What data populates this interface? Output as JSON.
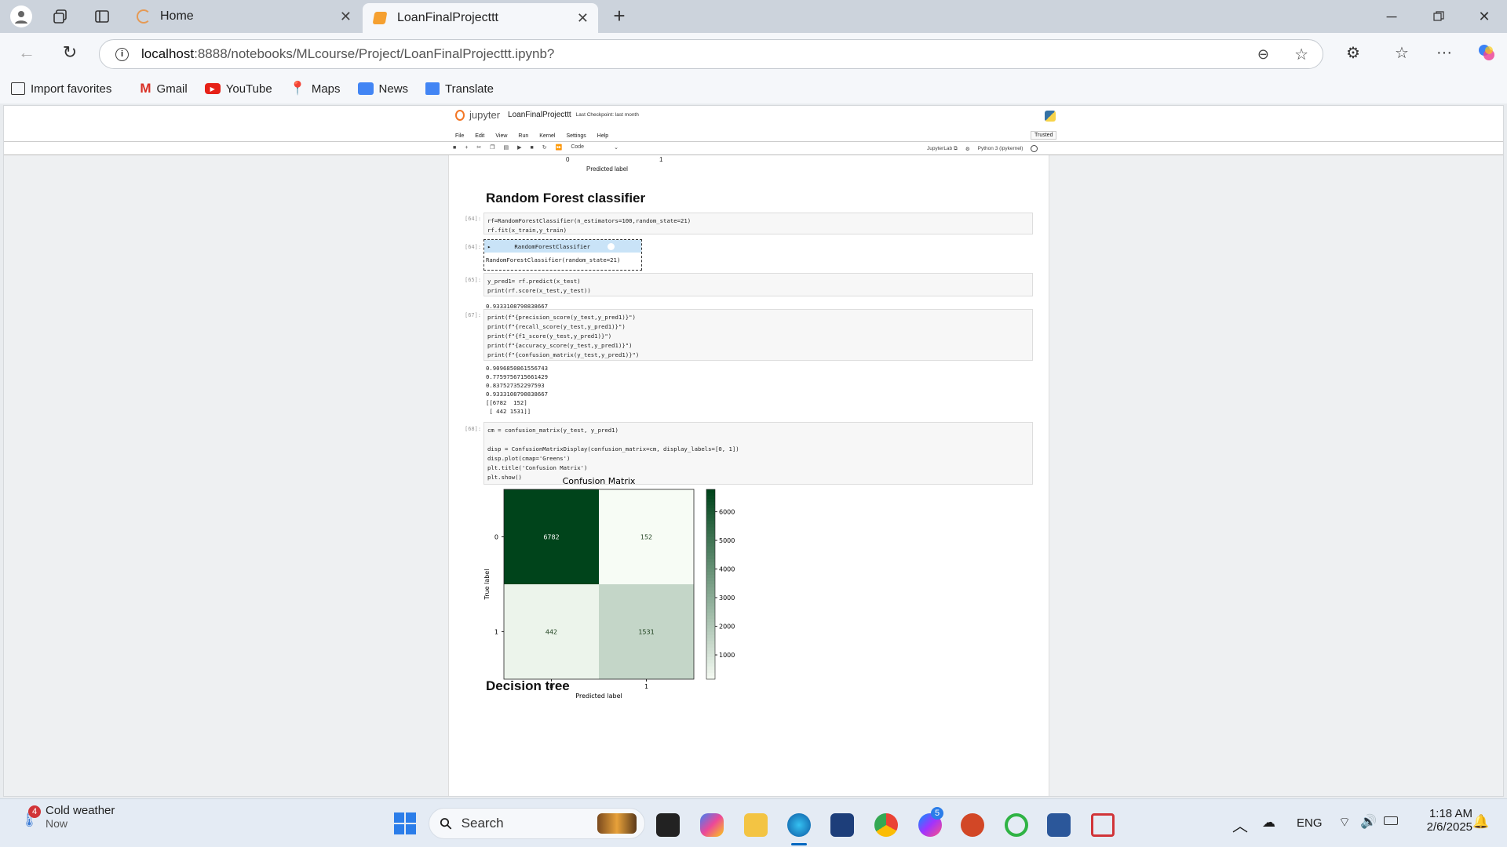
{
  "browser": {
    "tabs": [
      {
        "label": "Home"
      },
      {
        "label": "LoanFinalProjecttt"
      }
    ],
    "new_tab": "+",
    "url_host": "localhost",
    "url_rest": ":8888/notebooks/MLcourse/Project/LoanFinalProjecttt.ipynb?",
    "favorites": [
      {
        "label": "Import favorites",
        "icon": "import-favorites-icon"
      },
      {
        "label": "Gmail",
        "icon": "gmail-icon"
      },
      {
        "label": "YouTube",
        "icon": "youtube-icon"
      },
      {
        "label": "Maps",
        "icon": "maps-icon"
      },
      {
        "label": "News",
        "icon": "news-icon"
      },
      {
        "label": "Translate",
        "icon": "translate-icon"
      }
    ]
  },
  "jupyter": {
    "logo": "jupyter",
    "title": "LoanFinalProjecttt",
    "checkpoint": "Last Checkpoint: last month",
    "menu": [
      "File",
      "Edit",
      "View",
      "Run",
      "Kernel",
      "Settings",
      "Help"
    ],
    "trusted": "Trusted",
    "cell_type": "Code",
    "jupyterlab": "JupyterLab",
    "kernel": "Python 3 (ipykernel)"
  },
  "notebook": {
    "top_tick0": "0",
    "top_tick1": "1",
    "top_xlabel": "Predicted label",
    "heading1": "Random Forest classifier",
    "heading2": "Decision tree",
    "cell64_prompt": "[64]:",
    "cell64_line1": "rf=RandomForestClassifier(n_estimators=100,random_state=21)",
    "cell64_line2": "rf.fit(x_train,y_train)",
    "out64_prompt": "[64]:",
    "out64_title": "RandomForestClassifier",
    "out64_toggle": "▸",
    "out64_body": "RandomForestClassifier(random_state=21)",
    "cell65_prompt": "[65]:",
    "cell65_line1": "y_pred1= rf.predict(x_test)",
    "cell65_line2": "print(rf.score(x_test,y_test))",
    "out65": "0.9333108790838667",
    "cell67_prompt": "[67]:",
    "cell67_lines": [
      "print(f\"{precision_score(y_test,y_pred1)}\")",
      "print(f\"{recall_score(y_test,y_pred1)}\")",
      "print(f\"{f1_score(y_test,y_pred1)}\")",
      "print(f\"{accuracy_score(y_test,y_pred1)}\")",
      "print(f\"{confusion_matrix(y_test,y_pred1)}\")"
    ],
    "out67": [
      "0.9096850861556743",
      "0.7759756715661429",
      "0.837527352297593",
      "0.9333108790838667",
      "[[6782  152]",
      " [ 442 1531]]"
    ],
    "cell68_prompt": "[68]:",
    "cell68_lines": [
      "cm = confusion_matrix(y_test, y_pred1)",
      "",
      "disp = ConfusionMatrixDisplay(confusion_matrix=cm, display_labels=[0, 1])",
      "disp.plot(cmap='Greens')",
      "plt.title('Confusion Matrix')",
      "plt.show()"
    ]
  },
  "chart_data": {
    "type": "heatmap",
    "title": "Confusion Matrix",
    "xlabel": "Predicted label",
    "ylabel": "True label",
    "x_categories": [
      "0",
      "1"
    ],
    "y_categories": [
      "0",
      "1"
    ],
    "values": [
      [
        6782,
        152
      ],
      [
        442,
        1531
      ]
    ],
    "colorbar_ticks": [
      1000,
      2000,
      3000,
      4000,
      5000,
      6000
    ],
    "colorbar_range": [
      152,
      6782
    ],
    "colormap": "Greens"
  },
  "taskbar": {
    "weather_badge": "4",
    "weather_title": "Cold weather",
    "weather_sub": "Now",
    "search": "Search",
    "messenger_badge": "5",
    "lang": "ENG",
    "time": "1:18 AM",
    "date": "2/6/2025"
  }
}
